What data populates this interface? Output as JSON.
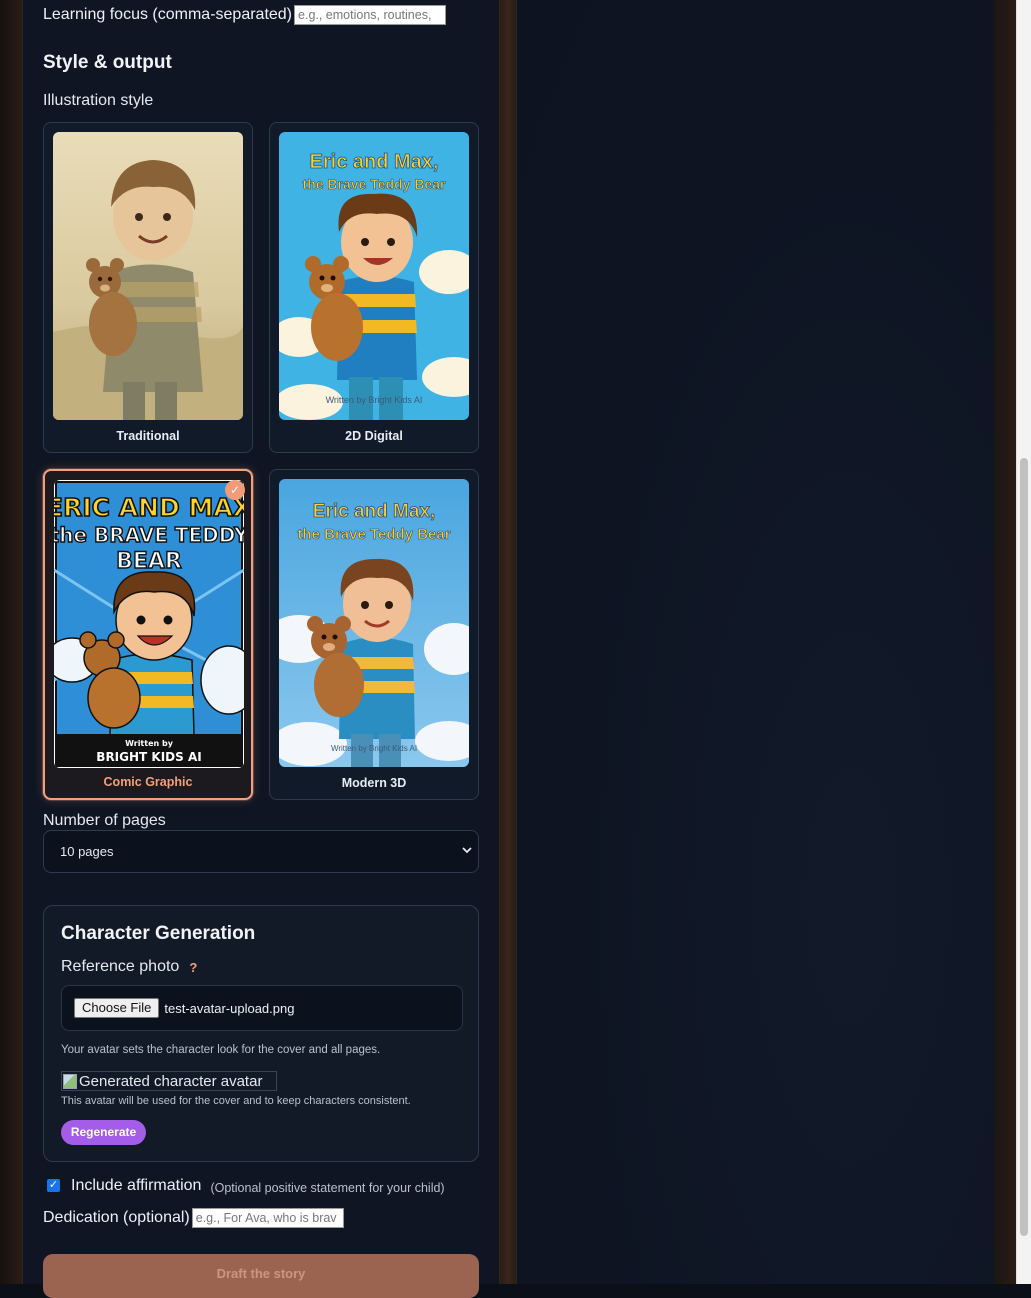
{
  "form": {
    "learning_focus": {
      "label": "Learning focus (comma-separated)",
      "placeholder": "e.g., emotions, routines,"
    },
    "style_heading": "Style & output",
    "illustration_label": "Illustration style",
    "styles": [
      {
        "label": "Traditional",
        "selected": false,
        "cover_title": "",
        "cover_credit": ""
      },
      {
        "label": "2D Digital",
        "selected": false,
        "cover_title": "Eric and Max, the Brave Teddy Bear",
        "cover_credit": "Written by Bright Kids AI"
      },
      {
        "label": "Comic Graphic",
        "selected": true,
        "cover_title": "ERIC AND MAX the BRAVE TEDDY BEAR",
        "cover_credit": "Written by BRIGHT KIDS AI"
      },
      {
        "label": "Modern 3D",
        "selected": false,
        "cover_title": "Eric and Max, the Brave Teddy Bear",
        "cover_credit": "Written by Bright Kids AI"
      }
    ],
    "pages": {
      "label": "Number of pages",
      "value": "10 pages"
    },
    "character": {
      "title": "Character Generation",
      "ref_label": "Reference photo",
      "help": "?",
      "choose_file": "Choose File",
      "file_name": "test-avatar-upload.png",
      "hint": "Your avatar sets the character look for the cover and all pages.",
      "avatar_alt": "Generated character avatar",
      "avatar_note": "This avatar will be used for the cover and to keep characters consistent.",
      "regenerate": "Regenerate"
    },
    "affirmation": {
      "label": "Include affirmation",
      "note": "(Optional positive statement for your child)",
      "checked": true
    },
    "dedication": {
      "label": "Dedication (optional)",
      "placeholder": "e.g., For Ava, who is brav"
    },
    "submit": "Draft the story"
  },
  "colors": {
    "accent_orange": "#f3a07e",
    "regenerate_purple": "#a45de8",
    "panel_bg": "#0f1522",
    "page_bg": "#0b0f18"
  }
}
